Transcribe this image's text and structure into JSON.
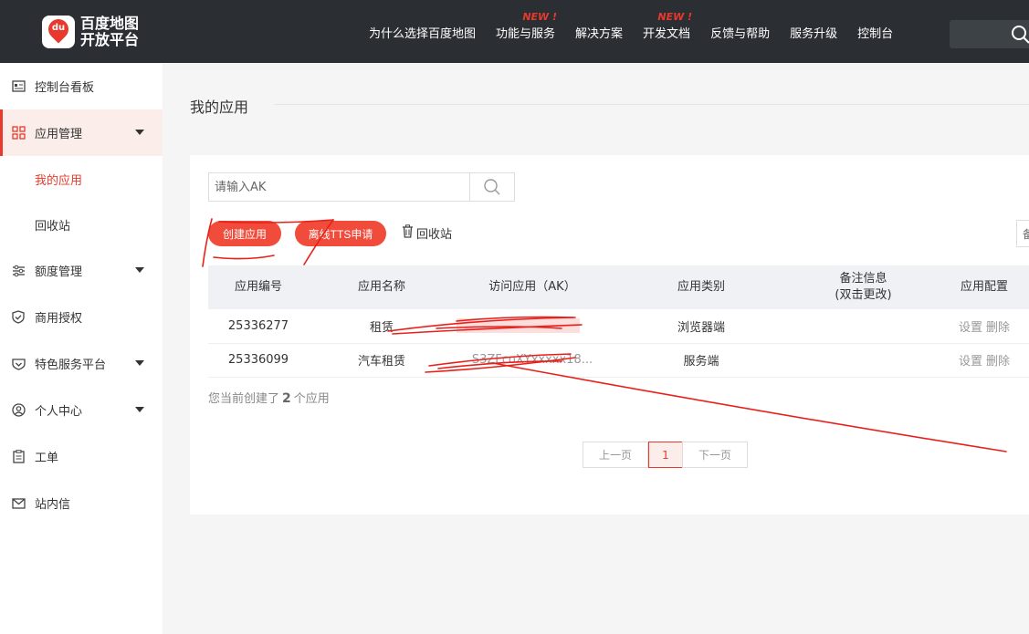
{
  "header": {
    "logo_badge": "du",
    "logo_text": "百度地图开放平台",
    "nav": [
      {
        "label": "为什么选择百度地图",
        "badge": ""
      },
      {
        "label": "功能与服务",
        "badge": "NEW !"
      },
      {
        "label": "解决方案",
        "badge": ""
      },
      {
        "label": "开发文档",
        "badge": "NEW !"
      },
      {
        "label": "反馈与帮助",
        "badge": ""
      },
      {
        "label": "服务升级",
        "badge": ""
      },
      {
        "label": "控制台",
        "badge": ""
      }
    ]
  },
  "sidebar": {
    "items": [
      {
        "label": "控制台看板",
        "icon": "dashboard-icon"
      },
      {
        "label": "应用管理",
        "icon": "grid-icon"
      },
      {
        "label": "我的应用"
      },
      {
        "label": "回收站"
      },
      {
        "label": "额度管理",
        "icon": "sliders-icon"
      },
      {
        "label": "商用授权",
        "icon": "shield-check-icon"
      },
      {
        "label": "特色服务平台",
        "icon": "heart-shield-icon"
      },
      {
        "label": "个人中心",
        "icon": "user-icon"
      },
      {
        "label": "工单",
        "icon": "ticket-icon"
      },
      {
        "label": "站内信",
        "icon": "mail-icon"
      }
    ]
  },
  "main": {
    "title": "我的应用",
    "search_placeholder": "请输入AK",
    "create_label": "创建应用",
    "tts_label": "离线TTS申请",
    "recycle_label": "回收站",
    "right_cut_label": "备",
    "table": {
      "headers": [
        "应用编号",
        "应用名称",
        "访问应用（AK）",
        "应用类别",
        "备注信息",
        "(双击更改)",
        "应用配置"
      ],
      "rows": [
        {
          "id": "25336277",
          "name": "租赁",
          "ak": "xxxxxxxxxxxxxxxx",
          "type": "浏览器端",
          "note": "",
          "set": "设置",
          "del": "删除"
        },
        {
          "id": "25336099",
          "name": "汽车租赁",
          "ak": "S3ZFcoXYxxxxx18...",
          "type": "服务端",
          "note": "",
          "set": "设置",
          "del": "删除"
        }
      ]
    },
    "count_prefix": "您当前创建了",
    "count_value": "2",
    "count_suffix": "个应用",
    "pager": {
      "prev": "上一页",
      "page": "1",
      "next": "下一页"
    }
  },
  "colors": {
    "accent": "#e8392c",
    "topbar": "#2b2f33"
  }
}
